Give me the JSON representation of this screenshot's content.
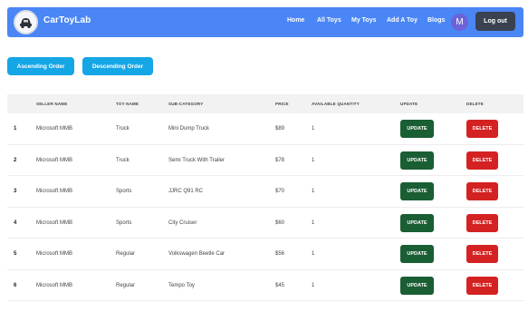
{
  "navbar": {
    "brand": "CarToyLab",
    "links": [
      "Home",
      "All Toys",
      "My Toys",
      "Add A Toy",
      "Blogs"
    ],
    "avatar_initial": "M",
    "logout_label": "Log out",
    "bg_color": "#4a86f5"
  },
  "sort": {
    "ascending_label": "Ascending Order",
    "descending_label": "Descending Order"
  },
  "table": {
    "headers": [
      "",
      "SELLER NAME",
      "TOY NAME",
      "SUB-CATEGORY",
      "PRICE",
      "AVAILABLE QUANTITY",
      "UPDATE",
      "DELETE"
    ],
    "update_label": "UPDATE",
    "delete_label": "DELETE",
    "rows": [
      {
        "index": "1",
        "seller": "Microsoft MMB",
        "toy": "Truck",
        "sub_category": "Mini Dump Truck",
        "price": "$89",
        "quantity": "1"
      },
      {
        "index": "2",
        "seller": "Microsoft MMB",
        "toy": "Truck",
        "sub_category": "Semi Truck With Trailer",
        "price": "$78",
        "quantity": "1"
      },
      {
        "index": "3",
        "seller": "Microsoft MMB",
        "toy": "Sports",
        "sub_category": "JJRC Q91 RC",
        "price": "$70",
        "quantity": "1"
      },
      {
        "index": "4",
        "seller": "Microsoft MMB",
        "toy": "Sports",
        "sub_category": "City Cruiser",
        "price": "$60",
        "quantity": "1"
      },
      {
        "index": "5",
        "seller": "Microsoft MMB",
        "toy": "Regular",
        "sub_category": "Volkswagen Beetle Car",
        "price": "$56",
        "quantity": "1"
      },
      {
        "index": "6",
        "seller": "Microsoft MMB",
        "toy": "Regular",
        "sub_category": "Tempo Toy",
        "price": "$45",
        "quantity": "1"
      }
    ]
  }
}
